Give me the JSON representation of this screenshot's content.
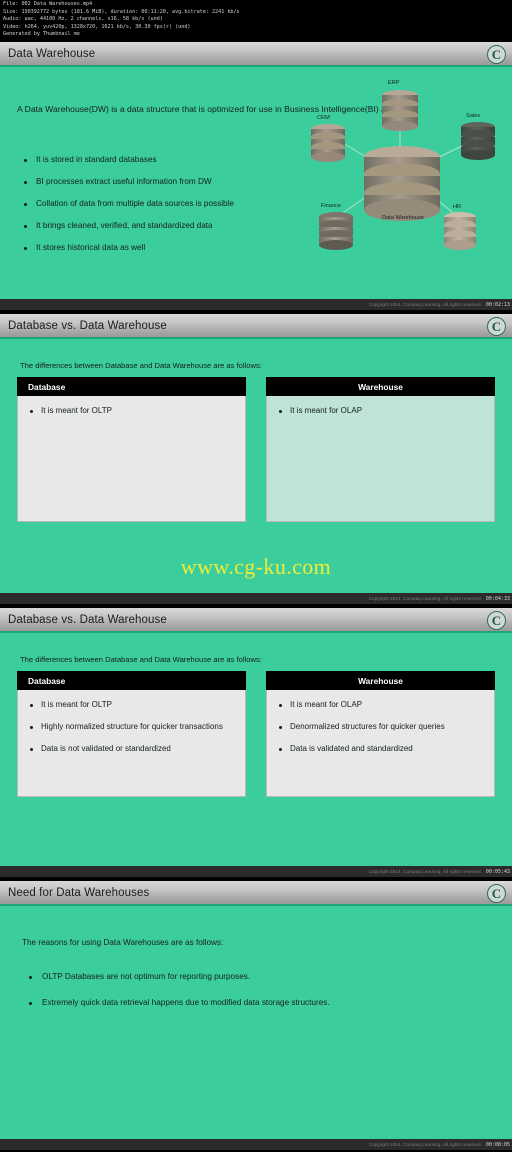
{
  "video_info": {
    "lines": [
      "File: 002 Data Warehouses.mp4",
      "Size: 190392772 bytes (181.6 MiB), duration: 00:11:20, avg.bitrate: 2241 kb/s",
      "Audio: aac, 44100 Hz, 2 channels, s16, 58 kb/s (und)",
      "Video: h264, yuv420p, 1328x720, 1621 kb/s, 30.30 fps(r) (und)",
      "Generated by Thumbnail me"
    ]
  },
  "colors": {
    "slide_background": "#3ccd9c",
    "title_bar": "#c4c4c4",
    "header_accent": "#1fa57e",
    "watermark": "#eded3a",
    "panel_gray": "#e8e8e8",
    "panel_green": "#bfe3d6"
  },
  "watermark": {
    "text": "www.cg-ku.com"
  },
  "footer": {
    "copyright": "Copyright 2014, Compaq Learning, All rights reserved."
  },
  "logo": {
    "glyph": "C",
    "name": "compaq-learning-logo"
  },
  "slides": [
    {
      "title": "Data Warehouse",
      "timestamp": "00:02:13",
      "paragraph": "A Data Warehouse(DW) is a data structure that is optimized for use in Business Intelligence(BI) activities.",
      "bullets": [
        "It is stored in standard databases",
        "BI processes extract useful information from DW",
        "Collation of data from multiple data sources is possible",
        "It brings cleaned, verified, and standardized data",
        "It stores historical data as well"
      ],
      "diagram": {
        "center_label": "Data Warehouse",
        "sources": [
          "ERP",
          "CRM",
          "Sales",
          "Finance",
          "HR"
        ]
      }
    },
    {
      "title": "Database vs. Data Warehouse",
      "timestamp": "00:04:33",
      "intro": "The differences between Database and Data Warehouse are as follows:",
      "left_header": "Database",
      "right_header": "Warehouse",
      "left_bullets": [
        "It is meant for OLTP"
      ],
      "right_bullets": [
        "It is meant for OLAP"
      ]
    },
    {
      "title": "Database vs. Data Warehouse",
      "timestamp": "00:05:43",
      "intro": "The differences between Database and Data Warehouse are as follows:",
      "left_header": "Database",
      "right_header": "Warehouse",
      "left_bullets": [
        "It is meant for OLTP",
        "Highly normalized structure for quicker transactions",
        "Data is not validated or standardized"
      ],
      "right_bullets": [
        "It is meant for OLAP",
        "Denormalized structures for quicker queries",
        "Data is validated and standardized"
      ]
    },
    {
      "title": "Need for Data Warehouses",
      "timestamp": "00:08:05",
      "intro": "The reasons for using Data Warehouses are as follows:",
      "bullets": [
        "OLTP Databases are not optimum for reporting purposes.",
        "Extremely quick data retrieval happens due to modified data storage structures."
      ]
    }
  ]
}
